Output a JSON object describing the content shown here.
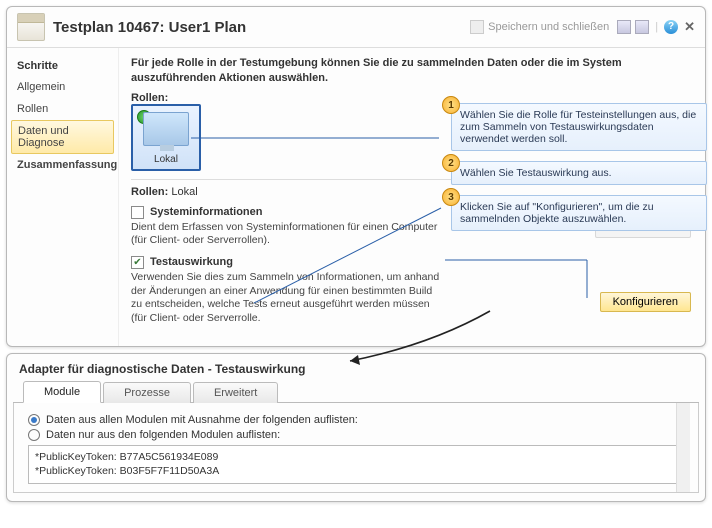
{
  "header": {
    "title": "Testplan 10467: User1 Plan",
    "save_close": "Speichern und schließen",
    "help_glyph": "?",
    "close_glyph": "✕"
  },
  "sidebar": {
    "heading": "Schritte",
    "items": [
      "Allgemein",
      "Rollen",
      "Daten und Diagnose",
      "Zusammenfassung"
    ],
    "selected_index": 2
  },
  "content": {
    "intro": "Für jede Rolle in der Testumgebung können Sie die zu sammelnden Daten oder die im System auszuführenden Aktionen auswählen.",
    "roles_label": "Rollen:",
    "role_tile": {
      "caption": "Lokal"
    },
    "roles_selected_label": "Rollen:",
    "roles_selected_value": "Lokal",
    "sysinfo": {
      "title": "Systeminformationen",
      "desc": "Dient dem Erfassen von Systeminformationen für einen Computer (für Client- oder Serverrollen)."
    },
    "impact": {
      "title": "Testauswirkung",
      "desc": "Verwenden Sie dies zum Sammeln von Informationen, um anhand der Änderungen an einer Anwendung für einen bestimmten Build zu entscheiden, welche Tests erneut ausgeführt werden müssen (für Client- oder Serverrolle."
    },
    "configure_btn": "Konfigurieren"
  },
  "callouts": [
    {
      "n": "1",
      "text": "Wählen Sie die Rolle für Testeinstellungen aus, die zum Sammeln von Testauswirkungsdaten verwendet werden soll."
    },
    {
      "n": "2",
      "text": "Wählen Sie Testauswirkung aus."
    },
    {
      "n": "3",
      "text": "Klicken Sie auf \"Konfigurieren\", um die zu sammelnden Objekte auszuwählen."
    }
  ],
  "panel2": {
    "title": "Adapter für diagnostische Daten - Testauswirkung",
    "tabs": [
      "Module",
      "Prozesse",
      "Erweitert"
    ],
    "active_tab": 0,
    "radio1": "Daten aus allen Modulen mit Ausnahme der folgenden auflisten:",
    "radio2": "Daten nur aus den folgenden Modulen auflisten:",
    "tokens": [
      "*PublicKeyToken: B77A5C561934E089",
      "*PublicKeyToken: B03F5F7F11D50A3A"
    ]
  }
}
